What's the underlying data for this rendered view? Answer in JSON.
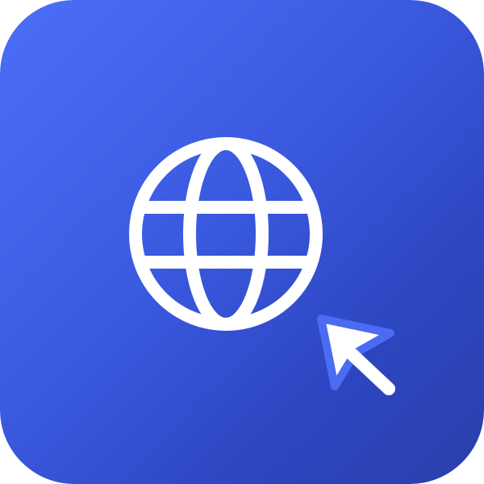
{
  "icon": {
    "glyph": "globe-icon",
    "cursor": "cursor-arrow-icon"
  },
  "colors": {
    "background_start": "#4C6EF6",
    "background_end": "#2A3FA9",
    "glyph": "#FFFFFF",
    "cursor_outline": "#4A6BF2"
  }
}
